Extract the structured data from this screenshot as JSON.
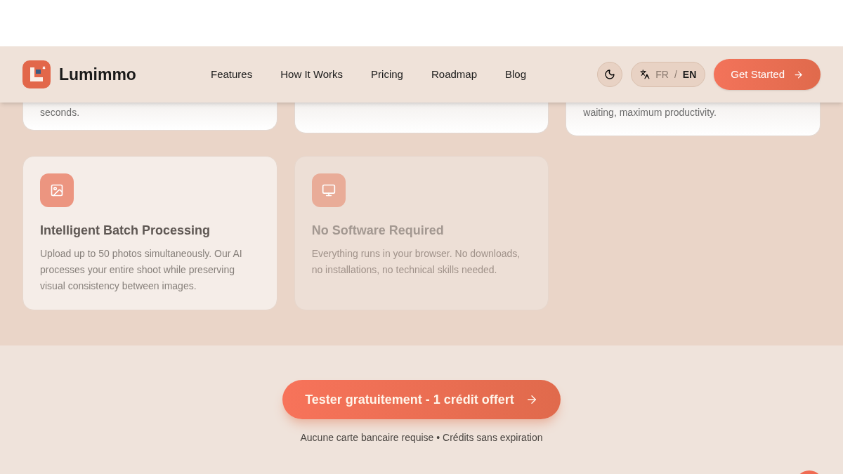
{
  "header": {
    "brand": "Lumimmo",
    "nav": [
      "Features",
      "How It Works",
      "Pricing",
      "Roadmap",
      "Blog"
    ],
    "languages": [
      {
        "code": "FR",
        "selected": false
      },
      {
        "code": "EN",
        "selected": true
      }
    ],
    "separator": "/",
    "cta": "Get Started"
  },
  "top_cards": [
    {
      "kind": "text",
      "text": "seconds."
    },
    {
      "kind": "blank"
    },
    {
      "kind": "text",
      "text": "waiting, maximum productivity."
    }
  ],
  "features": [
    {
      "kind": "image",
      "title": "Intelligent Batch Processing",
      "text": "Upload up to 50 photos simultaneously. Our AI processes your entire shoot while preserving visual consistency between images.",
      "dimmed": false
    },
    {
      "kind": "monitor",
      "title": "No Software Required",
      "text": "Everything runs in your browser. No downloads, no installations, no technical skills needed.",
      "dimmed": true
    }
  ],
  "cta": {
    "button": "Tester gratuitement - 1 crédit offert",
    "note": "Aucune carte bancaire requise • Crédits sans expiration"
  }
}
